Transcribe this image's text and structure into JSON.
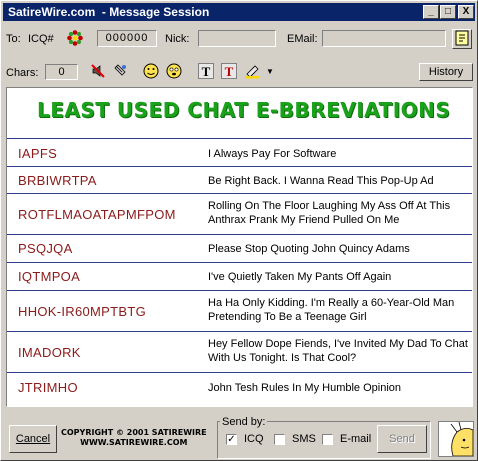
{
  "window": {
    "title": "SatireWire.com  - Message Session",
    "minimize": "_",
    "maximize": "□",
    "close": "X"
  },
  "toolbar": {
    "to_label": "To:",
    "icq_label": "ICQ#",
    "uin_value": "000000",
    "nick_label": "Nick:",
    "nick_value": "",
    "email_label": "EMail:",
    "email_value": "",
    "chars_label": "Chars:",
    "chars_value": "0",
    "history_label": "History"
  },
  "content": {
    "heading": "LEAST USED CHAT E-BBREVIATIONS",
    "items": [
      {
        "abbr": "IAPFS",
        "meaning": "I Always Pay For Software"
      },
      {
        "abbr": "BRBIWRTPA",
        "meaning": "Be Right Back. I Wanna Read This Pop-Up Ad"
      },
      {
        "abbr": "ROTFLMAOATAPMFPOM",
        "meaning": "Rolling On The Floor Laughing My Ass Off At This Anthrax Prank My Friend Pulled On Me"
      },
      {
        "abbr": "PSQJQA",
        "meaning": "Please Stop Quoting John Quincy Adams"
      },
      {
        "abbr": "IQTMPOA",
        "meaning": "I've Quietly Taken My Pants Off Again"
      },
      {
        "abbr": "HHOK-IR60MPTBTG",
        "meaning": "Ha Ha Only Kidding. I'm Really a 60-Year-Old Man Pretending To Be a Teenage Girl"
      },
      {
        "abbr": "IMADORK",
        "meaning": "Hey Fellow Dope Fiends, I've Invited My Dad To Chat With Us Tonight. Is That Cool?"
      },
      {
        "abbr": "JTRIMHO",
        "meaning": "John Tesh Rules In My Humble Opinion"
      }
    ]
  },
  "footer": {
    "cancel_label": "Cancel",
    "copyright_line1": "COPYRIGHT © 2001 SATIREWIRE",
    "copyright_line2": "WWW.SATIREWIRE.COM",
    "send_by_label": "Send by:",
    "icq_option": "ICQ",
    "icq_checked": "✓",
    "sms_option": "SMS",
    "email_option": "E-mail",
    "send_label": "Send"
  },
  "colors": {
    "titlebar": "#0a246a",
    "heading": "#1aa31a",
    "abbr": "#8b1a1a",
    "divider": "#2c3e8c"
  }
}
